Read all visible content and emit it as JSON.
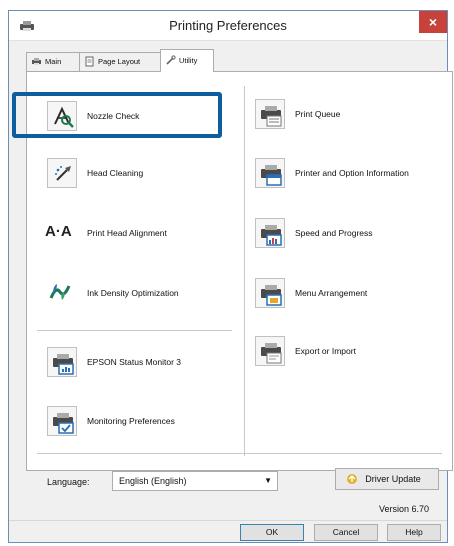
{
  "window": {
    "title": "Printing Preferences",
    "close": "×"
  },
  "tabs": [
    {
      "label": "Main",
      "icon": "printer-icon"
    },
    {
      "label": "Page Layout",
      "icon": "page-layout-icon"
    },
    {
      "label": "Utility",
      "icon": "wrench-icon"
    }
  ],
  "left_items": [
    {
      "label": "Nozzle Check",
      "icon": "nozzle-check-icon"
    },
    {
      "label": "Head Cleaning",
      "icon": "head-cleaning-icon"
    },
    {
      "label": "Print Head Alignment",
      "icon": "print-head-alignment-icon",
      "glyph": "A·A"
    },
    {
      "label": "Ink Density Optimization",
      "icon": "ink-density-icon"
    },
    {
      "label": "EPSON Status Monitor 3",
      "icon": "status-monitor-icon"
    },
    {
      "label": "Monitoring Preferences",
      "icon": "monitoring-preferences-icon"
    }
  ],
  "right_items": [
    {
      "label": "Print Queue",
      "icon": "print-queue-icon"
    },
    {
      "label": "Printer and Option Information",
      "icon": "printer-option-info-icon"
    },
    {
      "label": "Speed and Progress",
      "icon": "speed-progress-icon"
    },
    {
      "label": "Menu Arrangement",
      "icon": "menu-arrangement-icon"
    },
    {
      "label": "Export or Import",
      "icon": "export-import-icon"
    }
  ],
  "language": {
    "label": "Language:",
    "value": "English (English)"
  },
  "driver_update": {
    "label": "Driver Update",
    "icon": "driver-update-icon"
  },
  "version": "Version 6.70",
  "buttons": {
    "ok": "OK",
    "cancel": "Cancel",
    "help": "Help"
  },
  "colors": {
    "highlight": "#0f5c9e",
    "close": "#c7423a",
    "accent_blue": "#2a6fb4"
  }
}
